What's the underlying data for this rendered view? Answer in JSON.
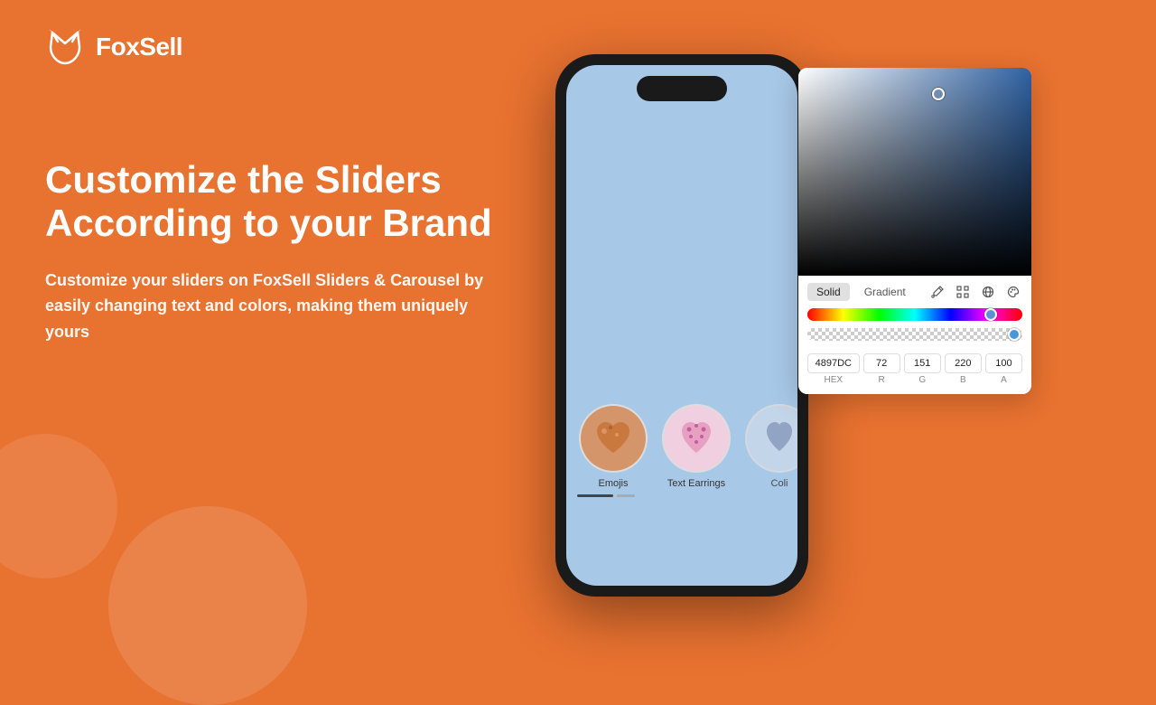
{
  "brand": {
    "name": "FoxSell",
    "logo_alt": "FoxSell logo"
  },
  "hero": {
    "heading": "Customize the Sliders According to your Brand",
    "subtext": "Customize your sliders on FoxSell Sliders & Carousel by easily changing text and colors, making them uniquely yours"
  },
  "phone": {
    "slider_items": [
      {
        "label": "Emojis",
        "active": true
      },
      {
        "label": "Text Earrings",
        "active": false
      },
      {
        "label": "Coli",
        "active": false
      }
    ]
  },
  "color_picker": {
    "tabs": [
      {
        "label": "Solid",
        "active": true
      },
      {
        "label": "Gradient",
        "active": false
      }
    ],
    "hex": "4897DC",
    "r": "72",
    "g": "151",
    "b": "220",
    "a": "100",
    "labels": {
      "hex": "HEX",
      "r": "R",
      "g": "G",
      "b": "B",
      "a": "A"
    }
  },
  "background_color": "#E87230"
}
